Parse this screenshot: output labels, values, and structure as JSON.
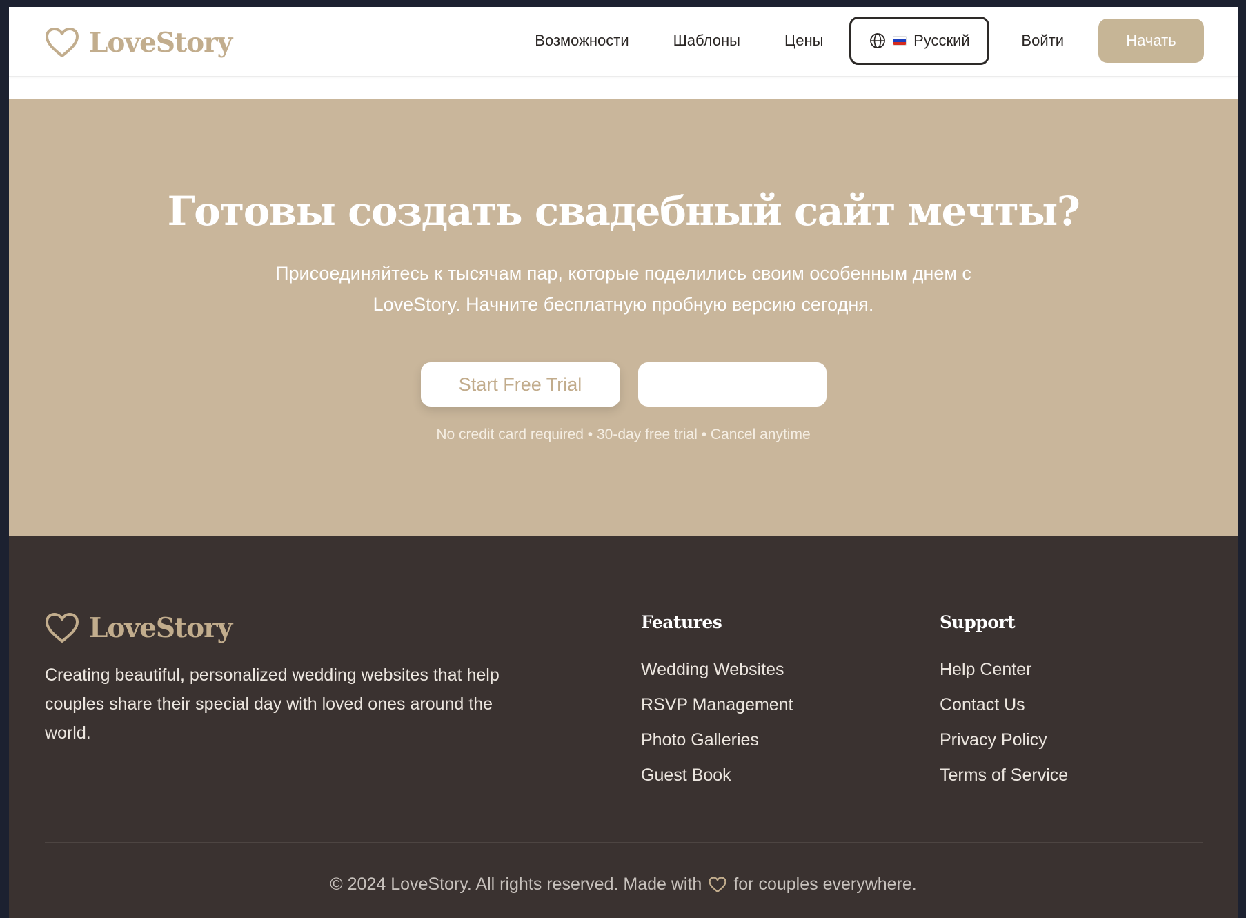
{
  "header": {
    "brand": "LoveStory",
    "nav": [
      {
        "label": "Возможности"
      },
      {
        "label": "Шаблоны"
      },
      {
        "label": "Цены"
      }
    ],
    "language": "Русский",
    "login": "Войти",
    "cta": "Начать"
  },
  "hero": {
    "title": "Готовы создать свадебный сайт мечты?",
    "subtitle": "Присоединяйтесь к тысячам пар, которые поделились своим особенным днем с LoveStory. Начните бесплатную пробную версию сегодня.",
    "primary_button": "Start Free Trial",
    "secondary_button": "",
    "note": "No credit card required • 30-day free trial • Cancel anytime"
  },
  "footer": {
    "brand": "LoveStory",
    "description": "Creating beautiful, personalized wedding websites that help couples share their special day with loved ones around the world.",
    "features": {
      "title": "Features",
      "links": [
        "Wedding Websites",
        "RSVP Management",
        "Photo Galleries",
        "Guest Book"
      ]
    },
    "support": {
      "title": "Support",
      "links": [
        "Help Center",
        "Contact Us",
        "Privacy Policy",
        "Terms of Service"
      ]
    },
    "copyright_before": "© 2024 LoveStory. All rights reserved. Made with",
    "copyright_after": "for couples everywhere."
  },
  "colors": {
    "brand": "#c2ad8d",
    "hero_bg": "#c9b69b",
    "footer_bg": "#3a3230",
    "button_bg": "#c6b596"
  },
  "icons": [
    "heart-icon",
    "globe-icon",
    "russian-flag-icon"
  ]
}
